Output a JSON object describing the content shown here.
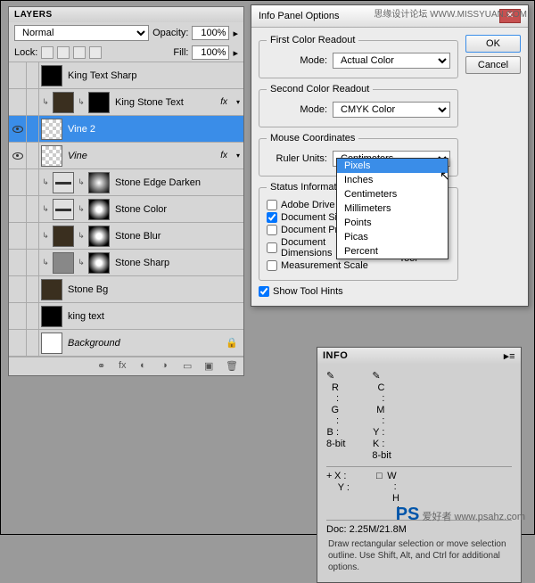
{
  "layersPanel": {
    "title": "LAYERS",
    "blendMode": "Normal",
    "opacityLabel": "Opacity:",
    "opacity": "100%",
    "lockLabel": "Lock:",
    "fillLabel": "Fill:",
    "fill": "100%",
    "layers": [
      {
        "name": "King Text Sharp",
        "vis": false,
        "thumbs": [
          "king"
        ],
        "fx": false,
        "italic": false
      },
      {
        "name": "King Stone Text",
        "vis": false,
        "thumbs": [
          "dark",
          "king"
        ],
        "fx": true,
        "italic": false,
        "clip": true
      },
      {
        "name": "Vine 2",
        "vis": true,
        "thumbs": [
          "checker"
        ],
        "fx": false,
        "selected": true
      },
      {
        "name": "Vine",
        "vis": true,
        "thumbs": [
          "checker"
        ],
        "fx": true,
        "italic": true
      },
      {
        "name": "Stone Edge Darken",
        "vis": false,
        "thumbs": [
          "line",
          "grad"
        ],
        "fx": false,
        "clip": true
      },
      {
        "name": "Stone Color",
        "vis": false,
        "thumbs": [
          "line",
          "radgrad"
        ],
        "fx": false,
        "clip": true
      },
      {
        "name": "Stone Blur",
        "vis": false,
        "thumbs": [
          "dark",
          "radgrad"
        ],
        "fx": false,
        "clip": true
      },
      {
        "name": "Stone Sharp",
        "vis": false,
        "thumbs": [
          "noise",
          "radgrad"
        ],
        "fx": false,
        "clip": true
      },
      {
        "name": "Stone Bg",
        "vis": false,
        "thumbs": [
          "dark"
        ],
        "fx": false
      },
      {
        "name": "king text",
        "vis": false,
        "thumbs": [
          "king"
        ],
        "fx": false
      },
      {
        "name": "Background",
        "vis": false,
        "thumbs": [
          "white"
        ],
        "fx": false,
        "italic": true,
        "lock": true
      }
    ]
  },
  "dialog": {
    "title": "Info Panel Options",
    "ok": "OK",
    "cancel": "Cancel",
    "group1": "First Color Readout",
    "group2": "Second Color Readout",
    "group3": "Mouse Coordinates",
    "group4": "Status Information",
    "modeLabel": "Mode:",
    "mode1": "Actual Color",
    "mode2": "CMYK Color",
    "rulerLabel": "Ruler Units:",
    "rulerValue": "Centimeters",
    "checks": {
      "adobe": "Adobe Drive",
      "docSizes": "Document Sizes",
      "docProfile": "Document Profile",
      "docDim": "Document Dimensions",
      "measure": "Measurement Scale",
      "current": "Current Tool"
    },
    "showHints": "Show Tool Hints"
  },
  "dropdown": {
    "items": [
      "Pixels",
      "Inches",
      "Centimeters",
      "Millimeters",
      "Points",
      "Picas",
      "Percent"
    ],
    "selected": 0
  },
  "infoPanel": {
    "title": "INFO",
    "r": "R :",
    "g": "G :",
    "b": "B :",
    "c": "C :",
    "m": "M :",
    "y": "Y :",
    "k": "K :",
    "bit": "8-bit",
    "x": "X :",
    "yc": "Y :",
    "w": "W :",
    "h": "H :",
    "doc": "Doc: 2.25M/21.8M",
    "hint": "Draw rectangular selection or move selection outline. Use Shift, Alt, and Ctrl for additional options."
  },
  "watermarks": {
    "top": "思缘设计论坛 WWW.MISSYUAN.COM",
    "bottom": "PS",
    "bottomSub": " 爱好者 www.psahz.com"
  }
}
